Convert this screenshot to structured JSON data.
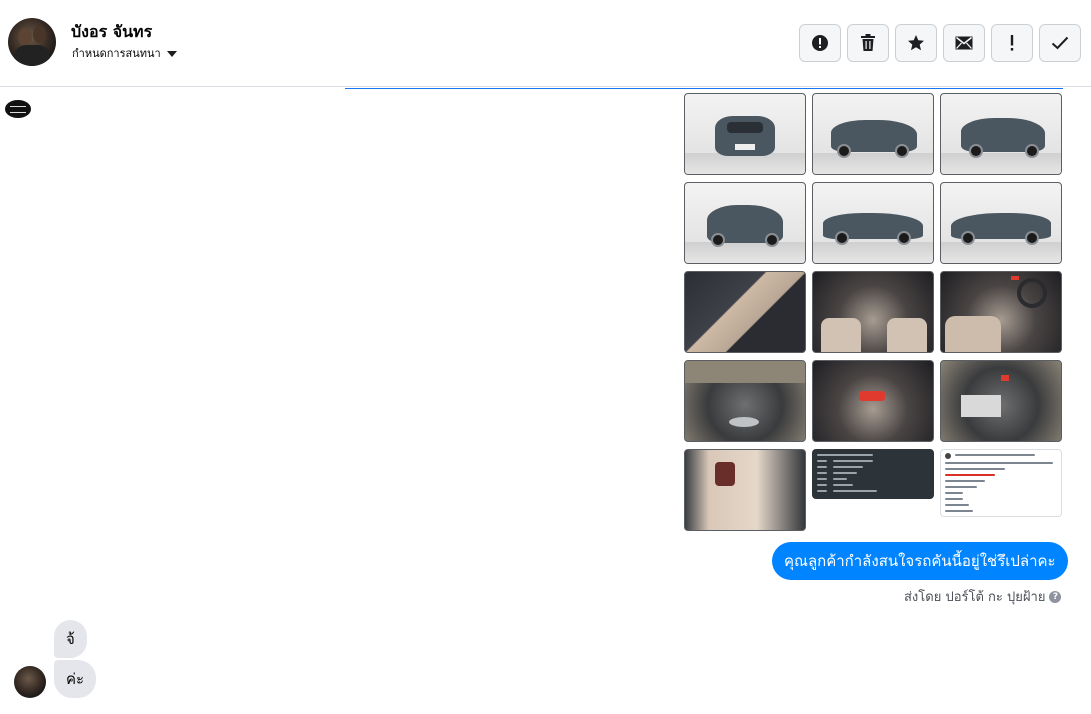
{
  "header": {
    "contact_name": "บังอร จันทร",
    "assign_label": "กำหนดการสนทนา",
    "actions": [
      {
        "name": "report-spam-button",
        "icon": "alert-circle-icon"
      },
      {
        "name": "delete-button",
        "icon": "trash-icon"
      },
      {
        "name": "star-button",
        "icon": "star-icon"
      },
      {
        "name": "mark-unread-button",
        "icon": "envelope-icon"
      },
      {
        "name": "mark-important-button",
        "icon": "exclamation-icon"
      },
      {
        "name": "mark-done-button",
        "icon": "check-icon"
      }
    ]
  },
  "thread": {
    "photos": [
      {
        "kind": "car-front"
      },
      {
        "kind": "car-front-side"
      },
      {
        "kind": "car-rear-side"
      },
      {
        "kind": "car-rear"
      },
      {
        "kind": "car-side"
      },
      {
        "kind": "car-side-left"
      },
      {
        "kind": "interior-door"
      },
      {
        "kind": "interior-dashboard"
      },
      {
        "kind": "interior-console"
      },
      {
        "kind": "engine-bay"
      },
      {
        "kind": "interior-gauges"
      },
      {
        "kind": "engine-closeup"
      },
      {
        "kind": "rear-seats"
      },
      {
        "kind": "doc-screenshot-dark"
      },
      {
        "kind": "doc-screenshot-light"
      }
    ],
    "outgoing_message": "คุณลูกค้ากำลังสนใจรถคันนี้อยู่ใช่รึเปล่าคะ",
    "sent_by": "ส่งโดย ปอร์โต้ กะ ปุยฝ้าย",
    "help_glyph": "?",
    "incoming_messages": [
      "จ้",
      "ค่ะ"
    ]
  },
  "colors": {
    "accent": "#1877f2",
    "outgoing_bubble": "#0084ff",
    "incoming_bubble": "#e4e6eb"
  }
}
